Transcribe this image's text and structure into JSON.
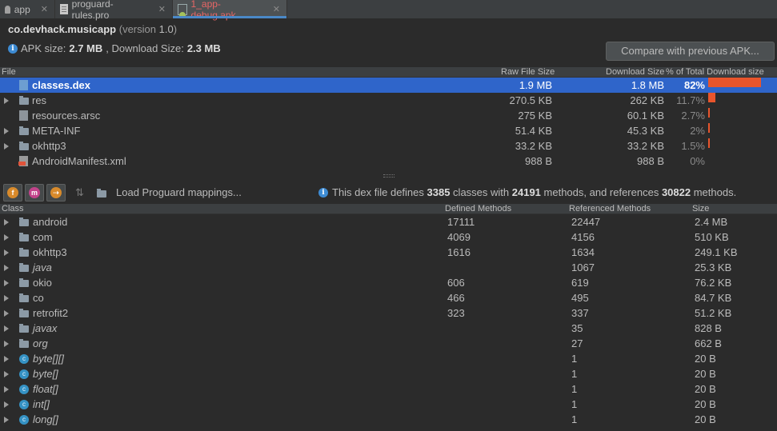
{
  "tabs": [
    {
      "label": "app",
      "icon": "android-icon",
      "active": false
    },
    {
      "label": "proguard-rules.pro",
      "icon": "file-icon",
      "active": false
    },
    {
      "label": "1_app-debug.apk",
      "icon": "apk-file-icon",
      "active": true
    }
  ],
  "header": {
    "package": "co.devhack.musicapp",
    "version_prefix": "(version ",
    "version": "1.0",
    "version_suffix": ")",
    "apk_size_label": "APK size:",
    "apk_size": "2.7 MB",
    "download_size_label": ", Download Size:",
    "download_size": "2.3 MB",
    "compare_button": "Compare with previous APK..."
  },
  "files_table": {
    "columns": [
      "File",
      "Raw File Size",
      "Download Size",
      "% of Total Download size"
    ],
    "rows": [
      {
        "name": "classes.dex",
        "raw": "1.9 MB",
        "download": "1.8 MB",
        "percent": "82%",
        "share": 82,
        "expandable": false,
        "icon": "dex-file-icon",
        "selected": true
      },
      {
        "name": "res",
        "raw": "270.5 KB",
        "download": "262 KB",
        "percent": "11.7%",
        "share": 11.7,
        "expandable": true,
        "icon": "folder-icon",
        "selected": false
      },
      {
        "name": "resources.arsc",
        "raw": "275 KB",
        "download": "60.1 KB",
        "percent": "2.7%",
        "share": 2.7,
        "expandable": false,
        "icon": "arsc-file-icon",
        "selected": false
      },
      {
        "name": "META-INF",
        "raw": "51.4 KB",
        "download": "45.3 KB",
        "percent": "2%",
        "share": 2,
        "expandable": true,
        "icon": "folder-icon",
        "selected": false
      },
      {
        "name": "okhttp3",
        "raw": "33.2 KB",
        "download": "33.2 KB",
        "percent": "1.5%",
        "share": 1.5,
        "expandable": true,
        "icon": "folder-icon",
        "selected": false
      },
      {
        "name": "AndroidManifest.xml",
        "raw": "988 B",
        "download": "988 B",
        "percent": "0%",
        "share": 0,
        "expandable": false,
        "icon": "xml-file-icon",
        "selected": false
      }
    ]
  },
  "toolbar": {
    "buttons": [
      {
        "name": "show-fields-button",
        "glyph": "f",
        "color": "#d88a2b"
      },
      {
        "name": "show-methods-button",
        "glyph": "m",
        "color": "#c2438a"
      },
      {
        "name": "show-referenced-only-button",
        "glyph": "r",
        "color": "#d88a2b"
      }
    ],
    "load_mappings": "Load Proguard mappings...",
    "dex_info_prefix": "This dex file defines ",
    "classes_count": "3385",
    "classes_mid": " classes with ",
    "methods_count": "24191",
    "methods_mid": " methods, and references ",
    "references_count": "30822",
    "references_suffix": " methods."
  },
  "classes_table": {
    "columns": [
      "Class",
      "Defined Methods",
      "Referenced Methods",
      "Size"
    ],
    "rows": [
      {
        "name": "android",
        "defined": "17111",
        "referenced": "22447",
        "size": "2.4 MB",
        "type": "package",
        "italic": false
      },
      {
        "name": "com",
        "defined": "4069",
        "referenced": "4156",
        "size": "510 KB",
        "type": "package",
        "italic": false
      },
      {
        "name": "okhttp3",
        "defined": "1616",
        "referenced": "1634",
        "size": "249.1 KB",
        "type": "package",
        "italic": false
      },
      {
        "name": "java",
        "defined": "",
        "referenced": "1067",
        "size": "25.3 KB",
        "type": "package",
        "italic": true
      },
      {
        "name": "okio",
        "defined": "606",
        "referenced": "619",
        "size": "76.2 KB",
        "type": "package",
        "italic": false
      },
      {
        "name": "co",
        "defined": "466",
        "referenced": "495",
        "size": "84.7 KB",
        "type": "package",
        "italic": false
      },
      {
        "name": "retrofit2",
        "defined": "323",
        "referenced": "337",
        "size": "51.2 KB",
        "type": "package",
        "italic": false
      },
      {
        "name": "javax",
        "defined": "",
        "referenced": "35",
        "size": "828 B",
        "type": "package",
        "italic": true
      },
      {
        "name": "org",
        "defined": "",
        "referenced": "27",
        "size": "662 B",
        "type": "package",
        "italic": true
      },
      {
        "name": "byte[][]",
        "defined": "",
        "referenced": "1",
        "size": "20 B",
        "type": "class",
        "italic": true
      },
      {
        "name": "byte[]",
        "defined": "",
        "referenced": "1",
        "size": "20 B",
        "type": "class",
        "italic": true
      },
      {
        "name": "float[]",
        "defined": "",
        "referenced": "1",
        "size": "20 B",
        "type": "class",
        "italic": true
      },
      {
        "name": "int[]",
        "defined": "",
        "referenced": "1",
        "size": "20 B",
        "type": "class",
        "italic": true
      },
      {
        "name": "long[]",
        "defined": "",
        "referenced": "1",
        "size": "20 B",
        "type": "class",
        "italic": true
      }
    ]
  }
}
